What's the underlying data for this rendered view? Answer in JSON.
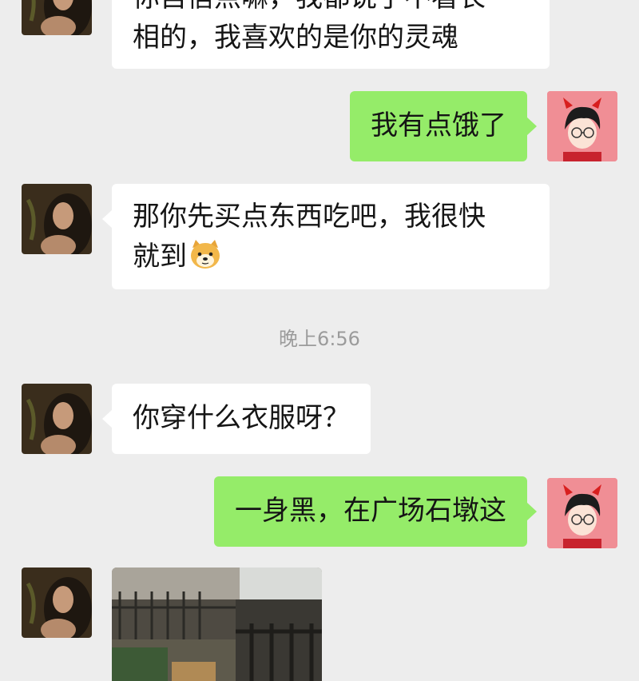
{
  "messages": [
    {
      "line1": "你自信点嘛，我都说了不看长",
      "line2": "相的，我喜欢的是你的灵魂"
    },
    {
      "text": "我有点饿了"
    },
    {
      "line1": "那你先买点东西吃吧，我很快",
      "line2": "就到"
    },
    {
      "text": "你穿什么衣服呀？"
    },
    {
      "text": "一身黑，在广场石墩这"
    }
  ],
  "timestamp": "晚上6:56",
  "emoji": "doge-emoji",
  "colors": {
    "background": "#ededed",
    "incoming_bubble": "#ffffff",
    "outgoing_bubble": "#95ec69",
    "my_avatar_bg": "#f08e95"
  }
}
